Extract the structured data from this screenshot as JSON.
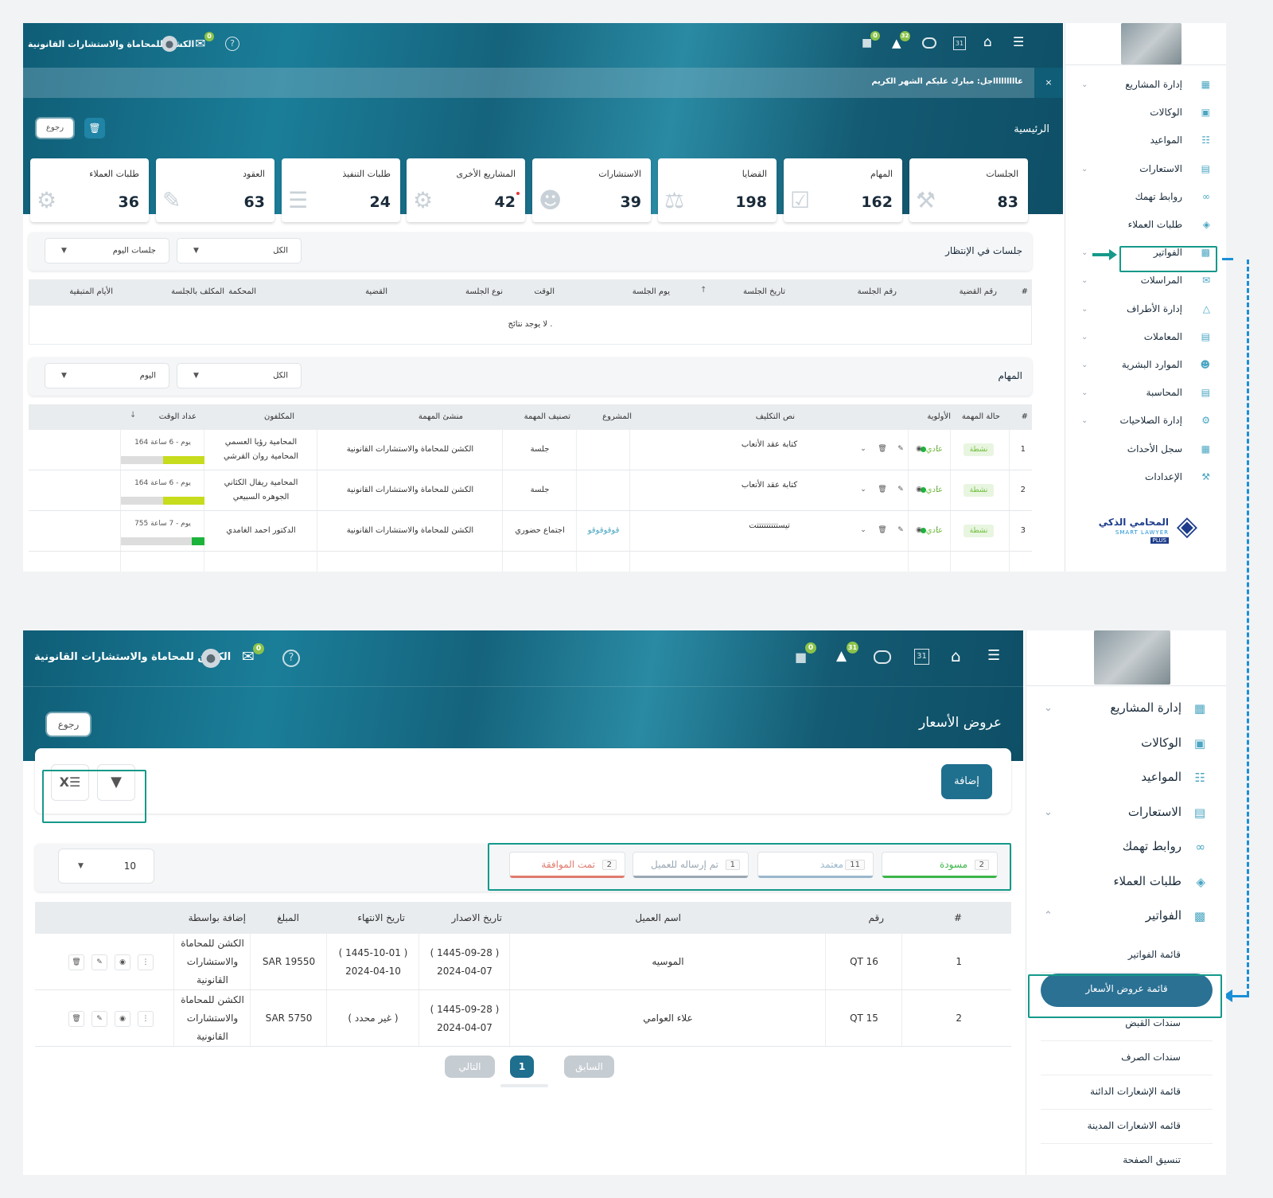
{
  "top_screen": {
    "header": {
      "company": "الكشن للمحاماة والاستشارات القانونية",
      "badges": {
        "chat": "0",
        "messages": "0",
        "notifications": "32"
      },
      "icons": [
        "user-icon",
        "message-icon",
        "help-icon",
        "chat-icon",
        "bell-icon",
        "toggle-icon",
        "calendar-icon",
        "home-icon",
        "menu-icon"
      ],
      "calendar_day": "31"
    },
    "announcement": {
      "text": "عاااااااااجل: مبارك عليكم الشهر الكريم",
      "close": "×"
    },
    "page_title": "الرئيسية",
    "back_label": "رجوع",
    "cards": [
      {
        "title": "الجلسات",
        "value": "83",
        "icon": "gavel-icon"
      },
      {
        "title": "المهام",
        "value": "162",
        "icon": "checklist-icon"
      },
      {
        "title": "القضايا",
        "value": "198",
        "icon": "scales-icon"
      },
      {
        "title": "الاستشارات",
        "value": "39",
        "icon": "consult-icon"
      },
      {
        "title": "المشاريع الأخرى",
        "value": "42",
        "icon": "project-icon"
      },
      {
        "title": "طلبات التنفيذ",
        "value": "24",
        "icon": "clipboard-icon"
      },
      {
        "title": "العقود",
        "value": "63",
        "icon": "contract-icon"
      },
      {
        "title": "طلبات العملاء",
        "value": "36",
        "icon": "client-gear-icon"
      }
    ],
    "sessions": {
      "title": "جلسات في الإنتظار",
      "filter_all": "الكل",
      "filter_today": "جلسات اليوم",
      "columns": [
        "#",
        "رقم القضية",
        "رقم الجلسة",
        "تاريخ الجلسة",
        "يوم الجلسة",
        "الوقت",
        "نوع الجلسة",
        "القضية",
        "المحكمة",
        "المكلف بالجلسة",
        "الأيام المتبقية"
      ],
      "empty": "لا يوجد نتائج ."
    },
    "tasks": {
      "title": "المهام",
      "filter_all": "الكل",
      "filter_today": "اليوم",
      "columns": [
        "#",
        "حالة المهمة",
        "الأولوية",
        "نص التكليف",
        "المشروع",
        "تصنيف المهمة",
        "منشئ المهمة",
        "المكلفون",
        "عداد الوقت"
      ],
      "rows": [
        {
          "n": "1",
          "status": "نشطة",
          "priority": "عادي",
          "text": "كتابة عقد الأتعاب",
          "project": "",
          "category": "جلسة",
          "creator": "الكشن للمحاماة والاستشارات القانونية",
          "assignees": [
            "المحامية رؤيا العسمي",
            "المحامية روان القرشي"
          ],
          "timer": "164 يوم - 6 ساعة",
          "progress": 0.5,
          "bar": "#c6dc1c"
        },
        {
          "n": "2",
          "status": "نشطة",
          "priority": "عادي",
          "text": "كتابة عقد الأتعاب",
          "project": "",
          "category": "جلسة",
          "creator": "الكشن للمحاماة والاستشارات القانونية",
          "assignees": [
            "المحامية ريفال الكثاني",
            "الجوهره السبيعي"
          ],
          "timer": "164 يوم - 6 ساعة",
          "progress": 0.5,
          "bar": "#c6dc1c"
        },
        {
          "n": "3",
          "status": "نشطة",
          "priority": "عادي",
          "text": "تيستتتتتتتتتت",
          "project": "قوقوقوقو",
          "category": "اجتماع حضوري",
          "creator": "الكشن للمحاماة والاستشارات القانونية",
          "assignees": [
            "الدكتور احمد الغامدي"
          ],
          "timer": "755 يوم - 7 ساعة",
          "progress": 0.15,
          "bar": "#1cb33a"
        }
      ]
    },
    "sidebar": {
      "items": [
        {
          "label": "إدارة المشاريع",
          "icon": "grid-icon",
          "chevron": true
        },
        {
          "label": "الوكالات",
          "icon": "briefcase-icon",
          "chevron": false
        },
        {
          "label": "المواعيد",
          "icon": "calendar-icon",
          "chevron": false
        },
        {
          "label": "الاستعارات",
          "icon": "document-icon",
          "chevron": true
        },
        {
          "label": "روابط تهمك",
          "icon": "link-icon",
          "chevron": false
        },
        {
          "label": "طلبات العملاء",
          "icon": "layers-icon",
          "chevron": false
        },
        {
          "label": "الفواتير",
          "icon": "invoice-icon",
          "chevron": true
        },
        {
          "label": "المراسلات",
          "icon": "mail-icon",
          "chevron": true
        },
        {
          "label": "إدارة الأطراف",
          "icon": "people-icon",
          "chevron": true
        },
        {
          "label": "المعاملات",
          "icon": "list-icon",
          "chevron": true
        },
        {
          "label": "الموارد البشرية",
          "icon": "team-icon",
          "chevron": true
        },
        {
          "label": "المحاسبة",
          "icon": "ledger-icon",
          "chevron": true
        },
        {
          "label": "إدارة الصلاحيات",
          "icon": "gear-icon",
          "chevron": true
        },
        {
          "label": "سجل الأحداث",
          "icon": "excel-icon",
          "chevron": false
        },
        {
          "label": "الإعدادات",
          "icon": "wrench-icon",
          "chevron": false
        }
      ],
      "logo_ar": "المحامي الذكي",
      "logo_en": "SMART LAWYER",
      "logo_plus": "PLUS"
    }
  },
  "bottom_screen": {
    "header": {
      "company": "الكشن للمحاماة والاستشارات القانونية",
      "badges": {
        "chat": "0",
        "messages": "0",
        "notifications": "31"
      },
      "calendar_day": "31"
    },
    "page_title": "عروض الأسعار",
    "back_label": "رجوع",
    "add_label": "إضافة",
    "page_size": "10",
    "tabs": [
      {
        "label": "مسودة",
        "count": "2",
        "color": "#3cb549"
      },
      {
        "label": "معتمد",
        "count": "11",
        "color": "#9ab7cc"
      },
      {
        "label": "تم إرساله للعميل",
        "count": "1",
        "color": "#9aa8b4"
      },
      {
        "label": "تمت الموافقة",
        "count": "2",
        "color": "#e07a6e"
      }
    ],
    "columns": [
      "#",
      "رقم",
      "اسم العميل",
      "تاريخ الاصدار",
      "تاريخ الانتهاء",
      "المبلغ",
      "إضافة بواسطة"
    ],
    "rows": [
      {
        "n": "1",
        "num": "QT 16",
        "client": "الموسيه",
        "issue_h": "( 1445-09-28 )",
        "issue_g": "2024-04-07",
        "end_h": "( 1445-10-01 )",
        "end_g": "2024-04-10",
        "amount": "SAR 19550",
        "by": [
          "الكشن للمحاماة",
          "والاستشارات",
          "القانونية"
        ]
      },
      {
        "n": "2",
        "num": "QT 15",
        "client": "علاء العوامي",
        "issue_h": "( 1445-09-28 )",
        "issue_g": "2024-04-07",
        "end_h": "( غير محدد )",
        "end_g": "",
        "amount": "SAR 5750",
        "by": [
          "الكشن للمحاماة",
          "والاستشارات",
          "القانونية"
        ]
      }
    ],
    "pagination": {
      "prev": "السابق",
      "page": "1",
      "next": "التالي"
    },
    "sidebar": {
      "items": [
        {
          "label": "إدارة المشاريع",
          "icon": "grid-icon",
          "chevron": "down"
        },
        {
          "label": "الوكالات",
          "icon": "briefcase-icon",
          "chevron": ""
        },
        {
          "label": "المواعيد",
          "icon": "calendar-icon",
          "chevron": ""
        },
        {
          "label": "الاستعارات",
          "icon": "document-icon",
          "chevron": "down"
        },
        {
          "label": "روابط تهمك",
          "icon": "link-icon",
          "chevron": ""
        },
        {
          "label": "طلبات العملاء",
          "icon": "layers-icon",
          "chevron": ""
        },
        {
          "label": "الفواتير",
          "icon": "invoice-icon",
          "chevron": "up"
        }
      ],
      "sub_items": [
        "قائمة الفواتير",
        "قائمة عروض الأسعار",
        "سندات القبض",
        "سندات الصرف",
        "قائمة الإشعارات الدائنة",
        "قائمه الاشعارات المدينة",
        "تنسيق الصفحة"
      ]
    }
  },
  "colors": {
    "accent": "#1d6f8c",
    "highlight": "#15998a",
    "connector": "#1a8fd6",
    "active_pill": "#2a7194"
  }
}
